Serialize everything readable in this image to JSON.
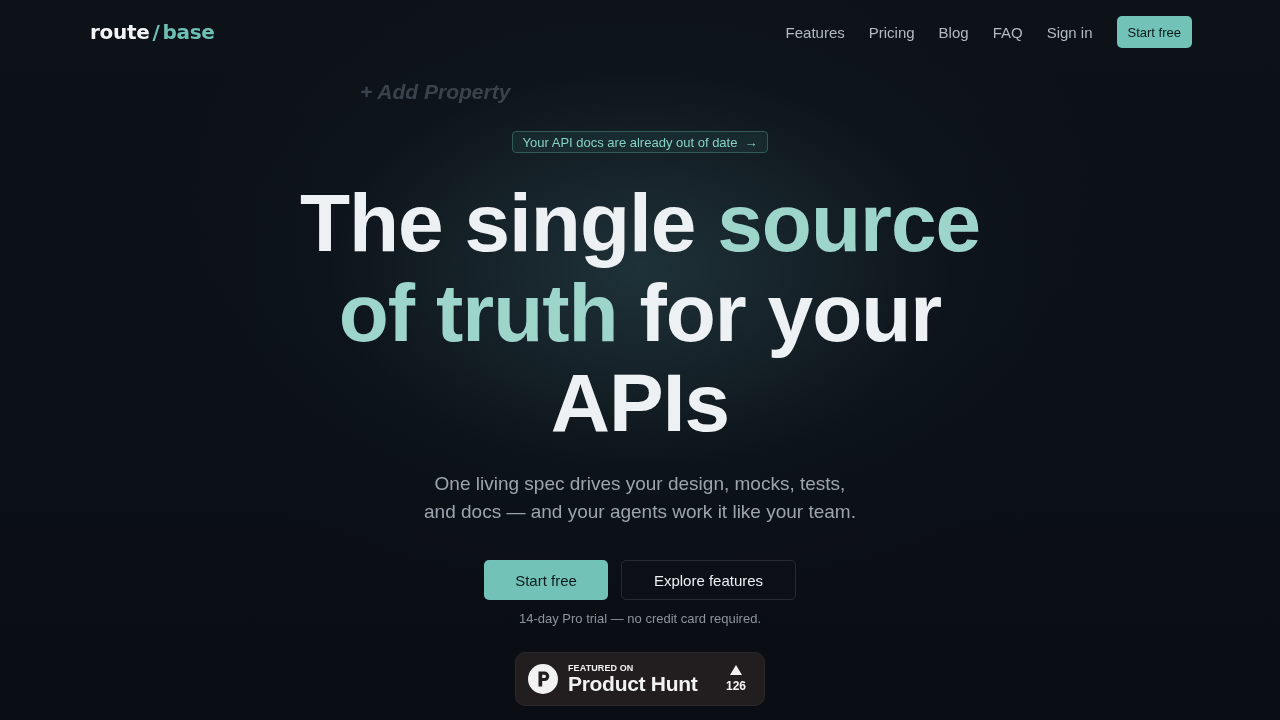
{
  "nav": {
    "logo": {
      "first": "route",
      "separator": "/",
      "second": "base"
    },
    "links": [
      "Features",
      "Pricing",
      "Blog",
      "FAQ",
      "Sign in"
    ],
    "cta": "Start free"
  },
  "background_text": "+ Add Property",
  "hero": {
    "announcement": {
      "label": "Your API docs are already out of date",
      "arrow": "→"
    },
    "headline": {
      "lines": [
        [
          {
            "text": "The single",
            "accent": false
          },
          {
            "text": "source",
            "accent": true
          }
        ],
        [
          {
            "text": "of truth",
            "accent": true
          },
          {
            "text": "for your",
            "accent": false
          }
        ],
        [
          {
            "text": "APIs",
            "accent": false
          }
        ]
      ]
    },
    "subtitle": "One living spec drives your design, mocks, tests, and docs — and your agents work it like your team.",
    "buttons": [
      {
        "label": "Start free",
        "kind": "primary"
      },
      {
        "label": "Explore features",
        "kind": "secondary"
      }
    ],
    "note": "14-day Pro trial — no credit card required.",
    "product_hunt": {
      "eyebrow": "FEATURED ON",
      "name": "Product Hunt",
      "votes": "126"
    }
  }
}
